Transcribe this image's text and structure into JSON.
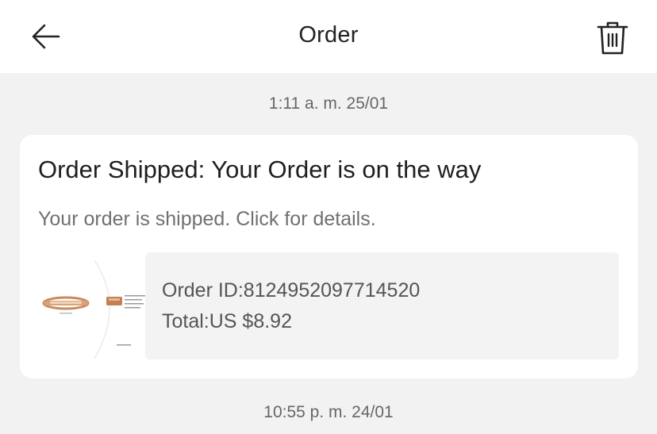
{
  "header": {
    "title": "Order",
    "back_icon": "arrow-left-icon",
    "trash_icon": "trash-icon"
  },
  "messages": [
    {
      "timestamp": "1:11 a. m. 25/01",
      "title": "Order Shipped: Your Order is on the way",
      "subtitle": "Your order is shipped. Click for details.",
      "order_id": "Order ID:8124952097714520",
      "total": "Total:US $8.92",
      "thumbnail_icon": "product-bracelet-image"
    }
  ],
  "next_timestamp": "10:55 p. m. 24/01",
  "colors": {
    "background": "#f2f2f2",
    "card": "#ffffff",
    "order_box": "#f3f3f3",
    "muted_text": "#707070"
  }
}
